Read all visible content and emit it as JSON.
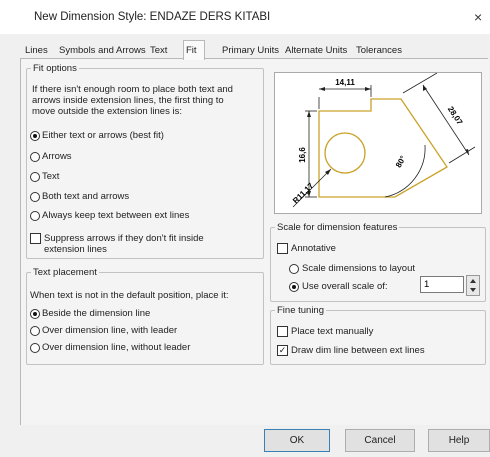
{
  "window": {
    "title": "New Dimension Style: ENDAZE DERS KITABI",
    "close": "×"
  },
  "tabs": [
    "Lines",
    "Symbols and Arrows",
    "Text",
    "Fit",
    "Primary Units",
    "Alternate Units",
    "Tolerances"
  ],
  "fit_options": {
    "legend": "Fit options",
    "description": [
      "If there isn't enough room to place both text and",
      "arrows inside extension lines, the first thing to",
      "move outside the extension lines is:"
    ],
    "options": [
      "Either text or arrows (best fit)",
      "Arrows",
      "Text",
      "Both text and arrows",
      "Always keep text between ext lines"
    ],
    "selected": 0,
    "suppress": {
      "label": [
        "Suppress arrows if they don't fit inside",
        "extension lines"
      ],
      "checked": false
    }
  },
  "text_placement": {
    "legend": "Text placement",
    "description": "When text is not in the default position, place it:",
    "options": [
      "Beside the dimension line",
      "Over dimension line, with leader",
      "Over dimension line, without leader"
    ],
    "selected": 0
  },
  "preview": {
    "labels": {
      "top": "14,11",
      "left": "16,6",
      "right": "28,07",
      "angle": "80°",
      "radius": "R11,17"
    },
    "stroke_color": "#c9a227"
  },
  "scale": {
    "legend": "Scale for dimension features",
    "annotative": {
      "label": "Annotative",
      "checked": false
    },
    "options": [
      "Scale dimensions to layout",
      "Use overall scale of:"
    ],
    "selected": 1,
    "value": "1"
  },
  "fine_tuning": {
    "legend": "Fine tuning",
    "place_text_manually": {
      "label": "Place text manually",
      "checked": false
    },
    "draw_dim_line": {
      "label": "Draw dim line between ext lines",
      "checked": true,
      "mark": "✓"
    }
  },
  "buttons": {
    "ok": "OK",
    "cancel": "Cancel",
    "help": "Help"
  }
}
